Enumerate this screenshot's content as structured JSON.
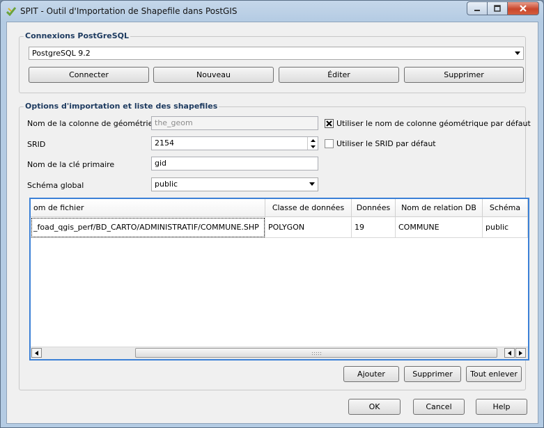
{
  "window": {
    "title": "SPIT - Outil d'Importation de Shapefile dans PostGIS"
  },
  "connections": {
    "group_title": "Connexions PostGreSQL",
    "selected": "PostgreSQL 9.2",
    "buttons": {
      "connect": "Connecter",
      "new": "Nouveau",
      "edit": "Éditer",
      "delete": "Supprimer"
    }
  },
  "options": {
    "group_title": "Options d'importation et liste des shapefiles",
    "geom_column_label": "Nom de la colonne de géométrie",
    "geom_column_value": "the_geom",
    "use_default_geom_label": "Utiliser le nom de colonne géométrique par défaut",
    "use_default_geom_checked": true,
    "srid_label": "SRID",
    "srid_value": "2154",
    "use_default_srid_label": "Utiliser le SRID par défaut",
    "use_default_srid_checked": false,
    "pk_label": "Nom de la clé primaire",
    "pk_value": "gid",
    "schema_label": "Schéma global",
    "schema_value": "public"
  },
  "table": {
    "columns": [
      "om de fichier",
      "Classe de données",
      "Données",
      "Nom de relation DB",
      "Schéma"
    ],
    "rows": [
      {
        "file": "_foad_qgis_perf/BD_CARTO/ADMINISTRATIF/COMMUNE.SHP",
        "class": "POLYGON",
        "data": "19",
        "relation": "COMMUNE",
        "schema": "public"
      }
    ]
  },
  "table_buttons": {
    "add": "Ajouter",
    "remove": "Supprimer",
    "remove_all": "Tout enlever"
  },
  "dialog_buttons": {
    "ok": "OK",
    "cancel": "Cancel",
    "help": "Help"
  },
  "colors": {
    "accent": "#3b80d6",
    "group_title": "#1e3b60"
  }
}
